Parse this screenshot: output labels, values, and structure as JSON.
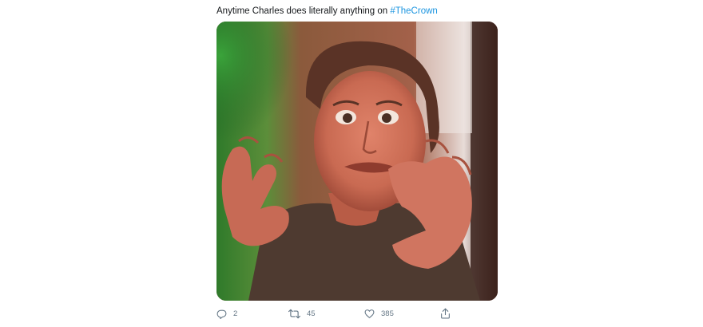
{
  "tweet": {
    "text": "Anytime Charles does literally anything on ",
    "hashtag": "#TheCrown"
  },
  "actions": {
    "reply": {
      "icon": "reply-icon",
      "count": "2"
    },
    "retweet": {
      "icon": "retweet-icon",
      "count": "45"
    },
    "like": {
      "icon": "heart-icon",
      "count": "385"
    },
    "share": {
      "icon": "share-icon"
    }
  },
  "colors": {
    "text": "#14171a",
    "link": "#1b95e0",
    "muted": "#657786"
  }
}
